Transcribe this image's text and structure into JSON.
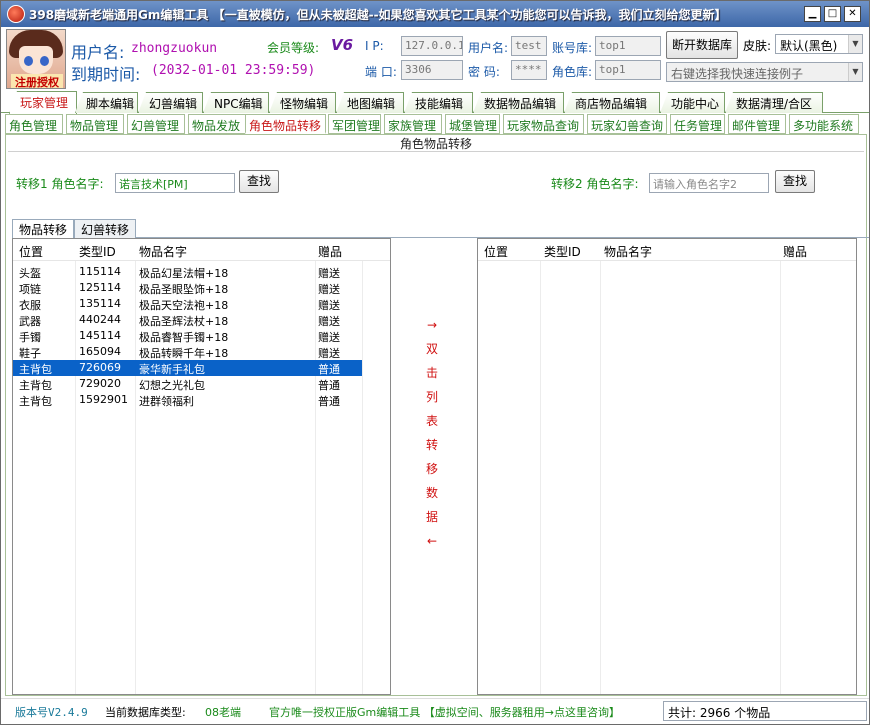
{
  "window": {
    "title": "398磨域新老端通用Gm编辑工具 【一直被模仿，但从未被超越--如果您喜欢其它工具某个功能您可以告诉我，我们立刻给您更新】",
    "min": "▁",
    "max": "□",
    "close": "✕"
  },
  "header": {
    "avatar_caption": "注册授权",
    "user_label": "用户名:",
    "user_value": "zhongzuokun",
    "member_label": "会员等级:",
    "member_value": "V6",
    "expire_label": "到期时间:",
    "expire_value": "(2032-01-01 23:59:59)",
    "ip_label": "I  P:",
    "ip_value": "127.0.0.1",
    "port_label": "端  口:",
    "port_value": "3306",
    "username_label": "用户名:",
    "username_value": "test",
    "password_label": "密  码:",
    "password_value": "****",
    "account_db_label": "账号库:",
    "account_db_value": "top1",
    "role_db_label": "角色库:",
    "role_db_value": "top1",
    "disconnect_button": "断开数据库",
    "skin_label": "皮肤:",
    "skin_value": "默认(黑色)",
    "quick_connect_placeholder": "右键选择我快速连接例子"
  },
  "main_tabs": [
    "玩家管理",
    "脚本编辑",
    "幻兽编辑",
    "NPC编辑",
    "怪物编辑",
    "地图编辑",
    "技能编辑",
    "数据物品编辑",
    "商店物品编辑",
    "功能中心",
    "数据清理/合区"
  ],
  "sub_tabs": [
    "角色管理",
    "物品管理",
    "幻兽管理",
    "物品发放",
    "角色物品转移",
    "军团管理",
    "家族管理",
    "城堡管理",
    "玩家物品查询",
    "玩家幻兽查询",
    "任务管理",
    "邮件管理",
    "多功能系统"
  ],
  "panel": {
    "title": "角色物品转移",
    "left_label": "转移1 角色名字:",
    "left_value": "诺言技术[PM]",
    "left_search": "查找",
    "right_label": "转移2 角色名字:",
    "right_placeholder": "请输入角色名字2",
    "right_search": "查找",
    "inner_tabs": [
      "物品转移",
      "幻兽转移"
    ],
    "columns": [
      "位置",
      "类型ID",
      "物品名字",
      "赠品"
    ],
    "left_rows": [
      {
        "pos": "头盔",
        "id": "115114",
        "name": "极品幻星法帽+18",
        "gift": "赠送"
      },
      {
        "pos": "项链",
        "id": "125114",
        "name": "极品圣眼坠饰+18",
        "gift": "赠送"
      },
      {
        "pos": "衣服",
        "id": "135114",
        "name": "极品天空法袍+18",
        "gift": "赠送"
      },
      {
        "pos": "武器",
        "id": "440244",
        "name": "极品圣辉法杖+18",
        "gift": "赠送"
      },
      {
        "pos": "手镯",
        "id": "145114",
        "name": "极品睿智手镯+18",
        "gift": "赠送"
      },
      {
        "pos": "鞋子",
        "id": "165094",
        "name": "极品转瞬千年+18",
        "gift": "赠送"
      },
      {
        "pos": "主背包",
        "id": "726069",
        "name": "豪华新手礼包",
        "gift": "普通"
      },
      {
        "pos": "主背包",
        "id": "729020",
        "name": "幻想之光礼包",
        "gift": "普通"
      },
      {
        "pos": "主背包",
        "id": "1592901",
        "name": "进群领福利",
        "gift": "普通"
      }
    ],
    "selected_row": 6,
    "middle_hint": [
      "→",
      "双",
      "击",
      "列",
      "表",
      "转",
      "移",
      "数",
      "据",
      "←"
    ]
  },
  "status": {
    "version": "版本号V2.4.9",
    "db_type_label": "当前数据库类型:",
    "db_type_value": "08老端",
    "notice": "官方唯一授权正版Gm编辑工具 【虚拟空间、服务器租用→点这里咨询】",
    "total": "共计: 2966 个物品"
  }
}
